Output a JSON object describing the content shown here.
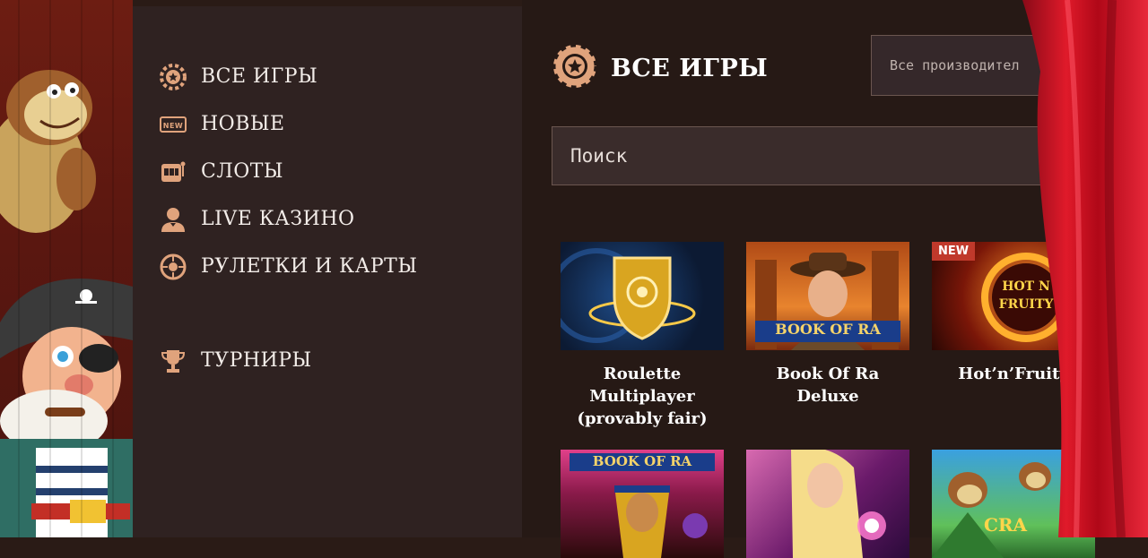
{
  "sidebar": {
    "items": [
      {
        "label": "ВСЕ ИГРЫ",
        "icon": "chip-icon"
      },
      {
        "label": "НОВЫЕ",
        "icon": "new-icon"
      },
      {
        "label": "СЛОТЫ",
        "icon": "slot-machine-icon"
      },
      {
        "label": "LIVE КАЗИНО",
        "icon": "dealer-icon"
      },
      {
        "label": "РУЛЕТКИ И КАРТЫ",
        "icon": "roulette-icon"
      }
    ],
    "tournaments": {
      "label": "ТУРНИРЫ",
      "icon": "trophy-icon"
    }
  },
  "main": {
    "title": "ВСЕ ИГРЫ",
    "provider_placeholder": "Все производител",
    "search_placeholder": "Поиск",
    "games": [
      {
        "title": "Roulette Multiplayer (provably fair)",
        "badge": ""
      },
      {
        "title": "Book Of Ra Deluxe",
        "badge": "",
        "thumb_text": "BOOK OF RA"
      },
      {
        "title": "Hot’n’Fruity",
        "badge": "NEW",
        "thumb_text": "HOT N FRUITY"
      },
      {
        "title": "",
        "badge": "",
        "thumb_text": "BOOK OF RA"
      },
      {
        "title": "",
        "badge": ""
      },
      {
        "title": "",
        "badge": "",
        "thumb_text": "CRA"
      }
    ]
  },
  "colors": {
    "accent": "#e0a37c",
    "sidebar_bg": "#2f2221",
    "main_bg": "#261915",
    "new_badge": "#c0392b"
  }
}
